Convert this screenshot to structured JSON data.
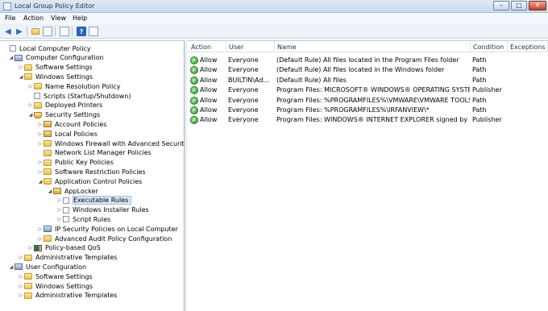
{
  "window": {
    "title": "Local Group Policy Editor",
    "controls": [
      "–",
      "□",
      "✕"
    ]
  },
  "menu": [
    "File",
    "Action",
    "View",
    "Help"
  ],
  "toolbar": {
    "back": "◀",
    "forward": "▶",
    "help": "?"
  },
  "tree": [
    {
      "label": "Local Computer Policy",
      "icon": "doc",
      "exp": ""
    },
    {
      "label": "Computer Configuration",
      "icon": "pc",
      "exp": "◢"
    },
    {
      "label": "Software Settings",
      "icon": "folder",
      "exp": "▷"
    },
    {
      "label": "Windows Settings",
      "icon": "folder",
      "exp": "◢"
    },
    {
      "label": "Name Resolution Policy",
      "icon": "folder",
      "exp": "▷"
    },
    {
      "label": "Scripts (Startup/Shutdown)",
      "icon": "doc",
      "exp": ""
    },
    {
      "label": "Deployed Printers",
      "icon": "folder",
      "exp": "▷"
    },
    {
      "label": "Security Settings",
      "icon": "shield",
      "exp": "◢"
    },
    {
      "label": "Account Policies",
      "icon": "lockfolder",
      "exp": "▷"
    },
    {
      "label": "Local Policies",
      "icon": "lockfolder",
      "exp": "▷"
    },
    {
      "label": "Windows Firewall with Advanced Security",
      "icon": "folder",
      "exp": "▷"
    },
    {
      "label": "Network List Manager Policies",
      "icon": "folder",
      "exp": ""
    },
    {
      "label": "Public Key Policies",
      "icon": "folder",
      "exp": "▷"
    },
    {
      "label": "Software Restriction Policies",
      "icon": "folder",
      "exp": "▷"
    },
    {
      "label": "Application Control Policies",
      "icon": "folder",
      "exp": "◢"
    },
    {
      "label": "AppLocker",
      "icon": "lockfolder",
      "exp": "◢"
    },
    {
      "label": "Executable Rules",
      "icon": "doc",
      "exp": "▷",
      "selected": true
    },
    {
      "label": "Windows Installer Rules",
      "icon": "doc",
      "exp": "▷"
    },
    {
      "label": "Script Rules",
      "icon": "doc",
      "exp": "▷"
    },
    {
      "label": "IP Security Policies on Local Computer",
      "icon": "pc",
      "exp": "▷"
    },
    {
      "label": "Advanced Audit Policy Configuration",
      "icon": "folder",
      "exp": "▷"
    },
    {
      "label": "Policy-based QoS",
      "icon": "bars",
      "exp": "▷"
    },
    {
      "label": "Administrative Templates",
      "icon": "folder",
      "exp": "▷"
    },
    {
      "label": "User Configuration",
      "icon": "pc",
      "exp": "◢"
    },
    {
      "label": "Software Settings",
      "icon": "folder",
      "exp": "▷"
    },
    {
      "label": "Windows Settings",
      "icon": "folder",
      "exp": "▷"
    },
    {
      "label": "Administrative Templates",
      "icon": "folder",
      "exp": "▷"
    }
  ],
  "columns": [
    "Action",
    "User",
    "Name",
    "Condition",
    "Exceptions"
  ],
  "rules": [
    {
      "action": "Allow",
      "user": "Everyone",
      "name": "(Default Rule) All files located in the Program Files folder",
      "condition": "Path",
      "exceptions": ""
    },
    {
      "action": "Allow",
      "user": "Everyone",
      "name": "(Default Rule) All files located in the Windows folder",
      "condition": "Path",
      "exceptions": ""
    },
    {
      "action": "Allow",
      "user": "BUILTIN\\Ad...",
      "name": "(Default Rule) All files",
      "condition": "Path",
      "exceptions": ""
    },
    {
      "action": "Allow",
      "user": "Everyone",
      "name": "Program Files: MICROSOFT® WINDOWS® OPERATING SYSTEM ...",
      "condition": "Publisher",
      "exceptions": ""
    },
    {
      "action": "Allow",
      "user": "Everyone",
      "name": "Program Files: %PROGRAMFILES%\\VMWARE\\VMWARE TOOLS\\*",
      "condition": "Path",
      "exceptions": ""
    },
    {
      "action": "Allow",
      "user": "Everyone",
      "name": "Program Files: %PROGRAMFILES%\\IRFANVIEW\\*",
      "condition": "Path",
      "exceptions": ""
    },
    {
      "action": "Allow",
      "user": "Everyone",
      "name": "Program Files: WINDOWS® INTERNET EXPLORER signed by O=...",
      "condition": "Publisher",
      "exceptions": ""
    }
  ]
}
